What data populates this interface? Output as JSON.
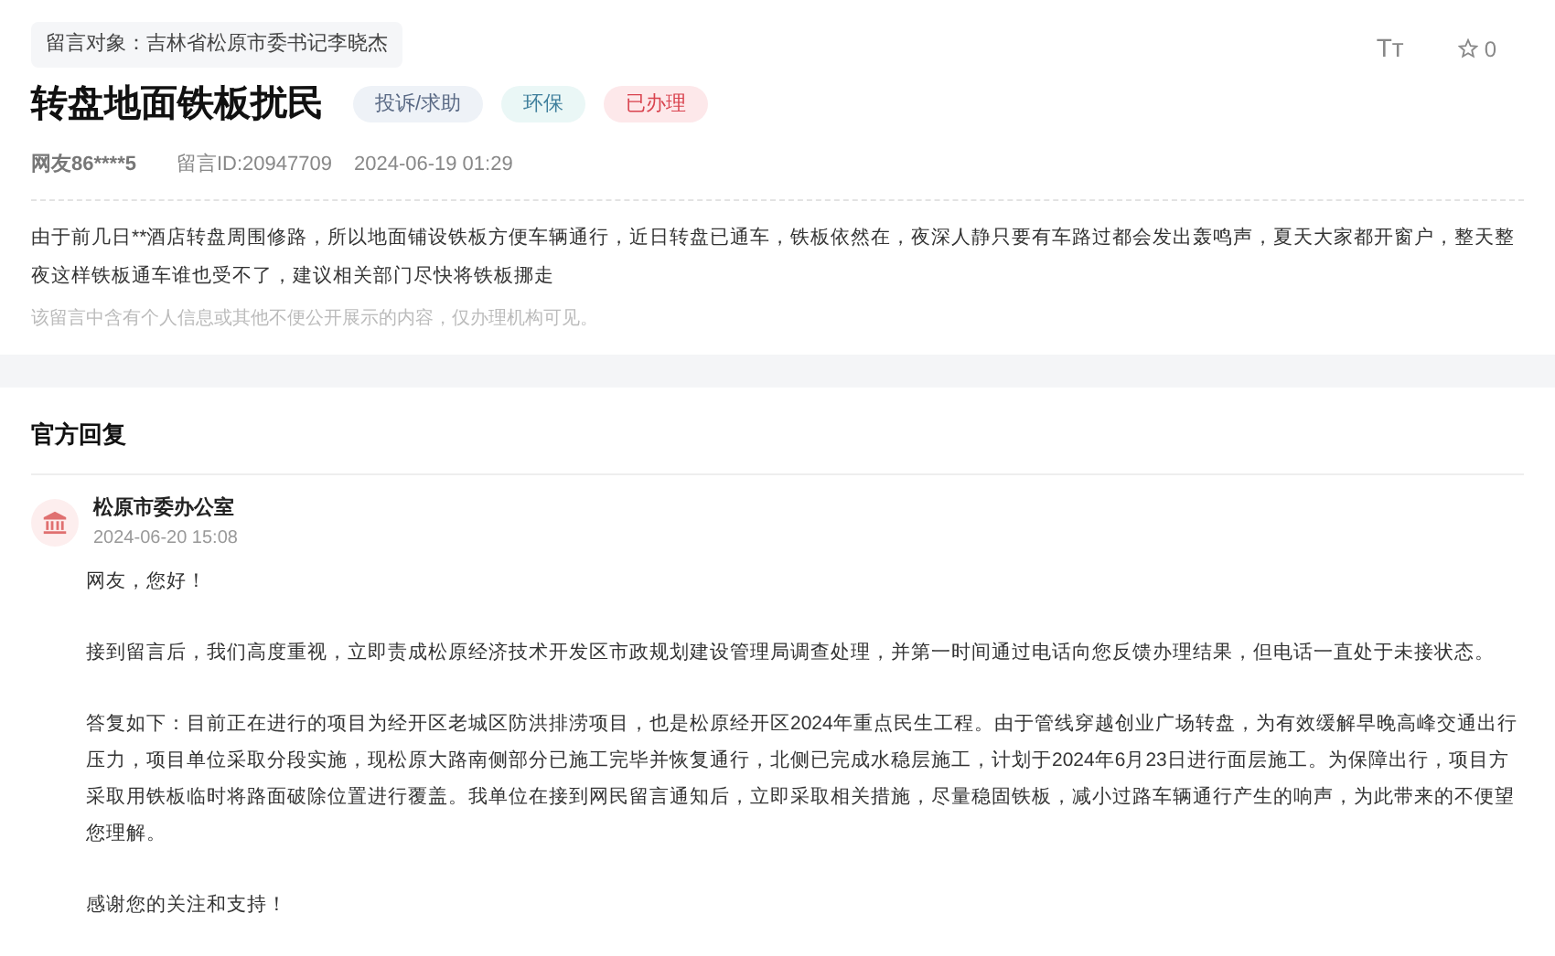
{
  "target": "留言对象：吉林省松原市委书记李晓杰",
  "toolbar": {
    "font_size": "Tт",
    "favorites": "0"
  },
  "title": "转盘地面铁板扰民",
  "tags": [
    {
      "label": "投诉/求助",
      "kind": "category"
    },
    {
      "label": "环保",
      "kind": "field"
    },
    {
      "label": "已办理",
      "kind": "status"
    }
  ],
  "meta": {
    "author": "网友86****5",
    "message_id": "留言ID:20947709",
    "time": "2024-06-19 01:29"
  },
  "body": "由于前几日**酒店转盘周围修路，所以地面铺设铁板方便车辆通行，近日转盘已通车，铁板依然在，夜深人静只要有车路过都会发出轰鸣声，夏天大家都开窗户，整天整夜这样铁板通车谁也受不了，建议相关部门尽快将铁板挪走",
  "notice": "该留言中含有个人信息或其他不便公开展示的内容，仅办理机构可见。",
  "reply": {
    "heading": "官方回复",
    "org": "松原市委办公室",
    "time": "2024-06-20 15:08",
    "paragraphs": [
      "网友，您好！",
      "接到留言后，我们高度重视，立即责成松原经济技术开发区市政规划建设管理局调查处理，并第一时间通过电话向您反馈办理结果，但电话一直处于未接状态。",
      "答复如下：目前正在进行的项目为经开区老城区防洪排涝项目，也是松原经开区2024年重点民生工程。由于管线穿越创业广场转盘，为有效缓解早晚高峰交通出行压力，项目单位采取分段实施，现松原大路南侧部分已施工完毕并恢复通行，北侧已完成水稳层施工，计划于2024年6月23日进行面层施工。为保障出行，项目方采取用铁板临时将路面破除位置进行覆盖。我单位在接到网民留言通知后，立即采取相关措施，尽量稳固铁板，减小过路车辆通行产生的响声，为此带来的不便望您理解。",
      "感谢您的关注和支持！"
    ]
  }
}
